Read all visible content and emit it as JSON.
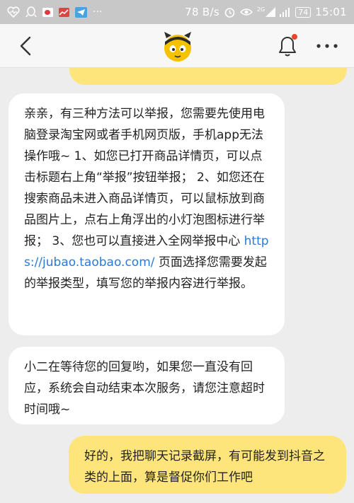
{
  "status_bar": {
    "net_speed": "78 B/s",
    "signal_label": "2G",
    "battery": "74",
    "time": "15:01"
  },
  "nav": {
    "back_icon": "chevron-left-icon",
    "logo_icon": "mascot-logo-icon",
    "bell_icon": "bell-icon",
    "more_icon": "more-dots-icon"
  },
  "colors": {
    "user_bubble": "#fde57b",
    "agent_bubble": "#ffffff",
    "link": "#2a7ad8",
    "accent": "#f5c200",
    "badge": "#e8452c"
  },
  "messages": [
    {
      "from": "agent",
      "text_before": "亲亲，有三种方法可以举报，您需要先使用电脑登录淘宝网或者手机网页版，手机app无法操作哦~ 1、如您已打开商品详情页，可以点击标题右上角“举报”按钮举报； 2、如您还在搜索商品未进入商品详情页，可以鼠标放到商品图片上，点右上角浮出的小灯泡图标进行举报； 3、您也可以直接进入全网举报中心 ",
      "link": "https://jubao.taobao.com/",
      "text_after": " 页面选择您需要发起的举报类型，填写您的举报内容进行举报。"
    },
    {
      "from": "agent",
      "text": "小二在等待您的回复哟，如果您一直没有回应，系统会自动结束本次服务，请您注意超时时间哦~"
    },
    {
      "from": "user",
      "text": "好的，我把聊天记录截屏，有可能发到抖音之类的上面，算是督促你们工作吧"
    }
  ]
}
